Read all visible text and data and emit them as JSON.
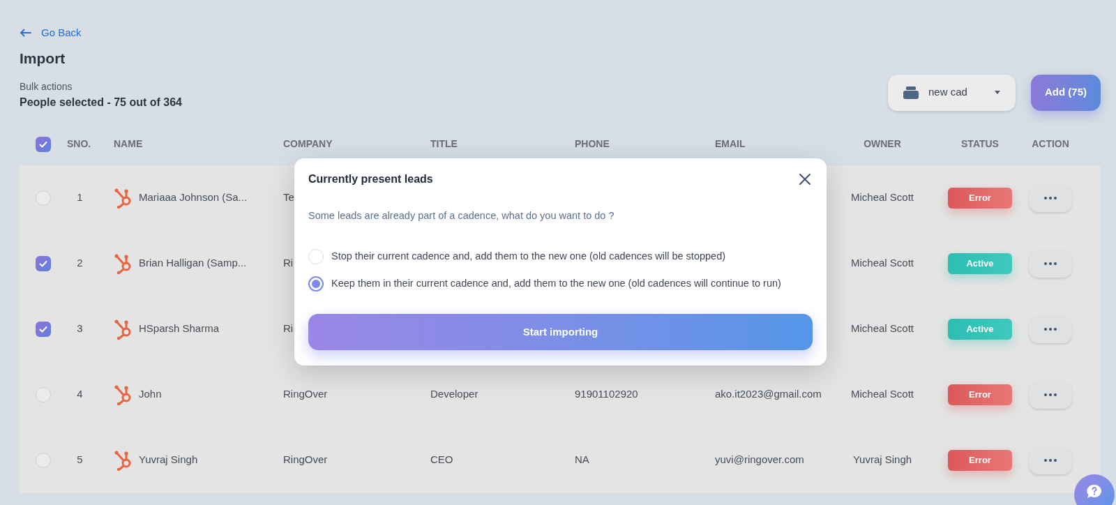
{
  "back_link": {
    "label": "Go Back"
  },
  "page_title": "Import",
  "bulk_actions": {
    "label": "Bulk actions",
    "summary": "People selected - 75 out of 364"
  },
  "cadence_select": {
    "value": "new cad"
  },
  "add_button": {
    "label": "Add (75)"
  },
  "table": {
    "select_all": {
      "checked": true
    },
    "columns": [
      "SNO.",
      "NAME",
      "COMPANY",
      "TITLE",
      "PHONE",
      "EMAIL",
      "OWNER",
      "STATUS",
      "ACTION"
    ],
    "rows": [
      {
        "checked": false,
        "sno": "1",
        "name": "Mariaaa Johnson (Sa...",
        "company": "Te",
        "owner": "Micheal Scott",
        "status": {
          "label": "Error",
          "kind": "error"
        }
      },
      {
        "checked": true,
        "sno": "2",
        "name": "Brian Halligan (Samp...",
        "company": "Ri",
        "owner": "Micheal Scott",
        "status": {
          "label": "Active",
          "kind": "active"
        }
      },
      {
        "checked": true,
        "sno": "3",
        "name": "HSparsh Sharma",
        "company": "Ri",
        "owner": "Micheal Scott",
        "status": {
          "label": "Active",
          "kind": "active"
        }
      },
      {
        "checked": false,
        "sno": "4",
        "name": "John",
        "company": "RingOver",
        "title": "Developer",
        "phone": "91901102920",
        "email": "ako.it2023@gmail.com",
        "owner": "Micheal Scott",
        "status": {
          "label": "Error",
          "kind": "error"
        }
      },
      {
        "checked": false,
        "sno": "5",
        "name": "Yuvraj Singh",
        "company": "RingOver",
        "title": "CEO",
        "phone": "NA",
        "email": "yuvi@ringover.com",
        "owner": "Yuvraj Singh",
        "status": {
          "label": "Error",
          "kind": "error"
        }
      }
    ]
  },
  "modal": {
    "title": "Currently present leads",
    "message": "Some leads are already part of a cadence, what do you want to do ?",
    "options": [
      {
        "label": "Stop their current cadence and, add them to the new one (old cadences will be stopped)",
        "selected": false
      },
      {
        "label": "Keep them in their current cadence and, add them to the new one (old cadences will continue to run)",
        "selected": true
      }
    ],
    "submit": "Start importing"
  }
}
